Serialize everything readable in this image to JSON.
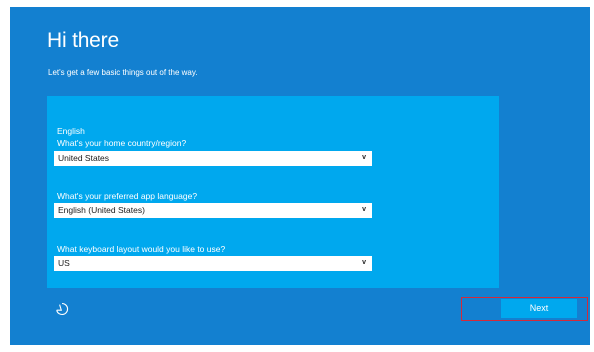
{
  "header": {
    "title": "Hi there",
    "subtitle": "Let's get a few basic things out of the way."
  },
  "form": {
    "section_label": "English",
    "country": {
      "label": "What's your home country/region?",
      "value": "United States"
    },
    "app_language": {
      "label": "What's your preferred app language?",
      "value": "English (United States)"
    },
    "keyboard": {
      "label": "What keyboard layout would you like to use?",
      "value": "US"
    },
    "dropdown_glyph": "v"
  },
  "footer": {
    "accessibility_icon": "ease-of-access-icon",
    "next_label": "Next"
  },
  "colors": {
    "background": "#1380d0",
    "panel": "#00a8ee",
    "text": "#ffffff",
    "highlight_outline": "#d42a3a"
  }
}
